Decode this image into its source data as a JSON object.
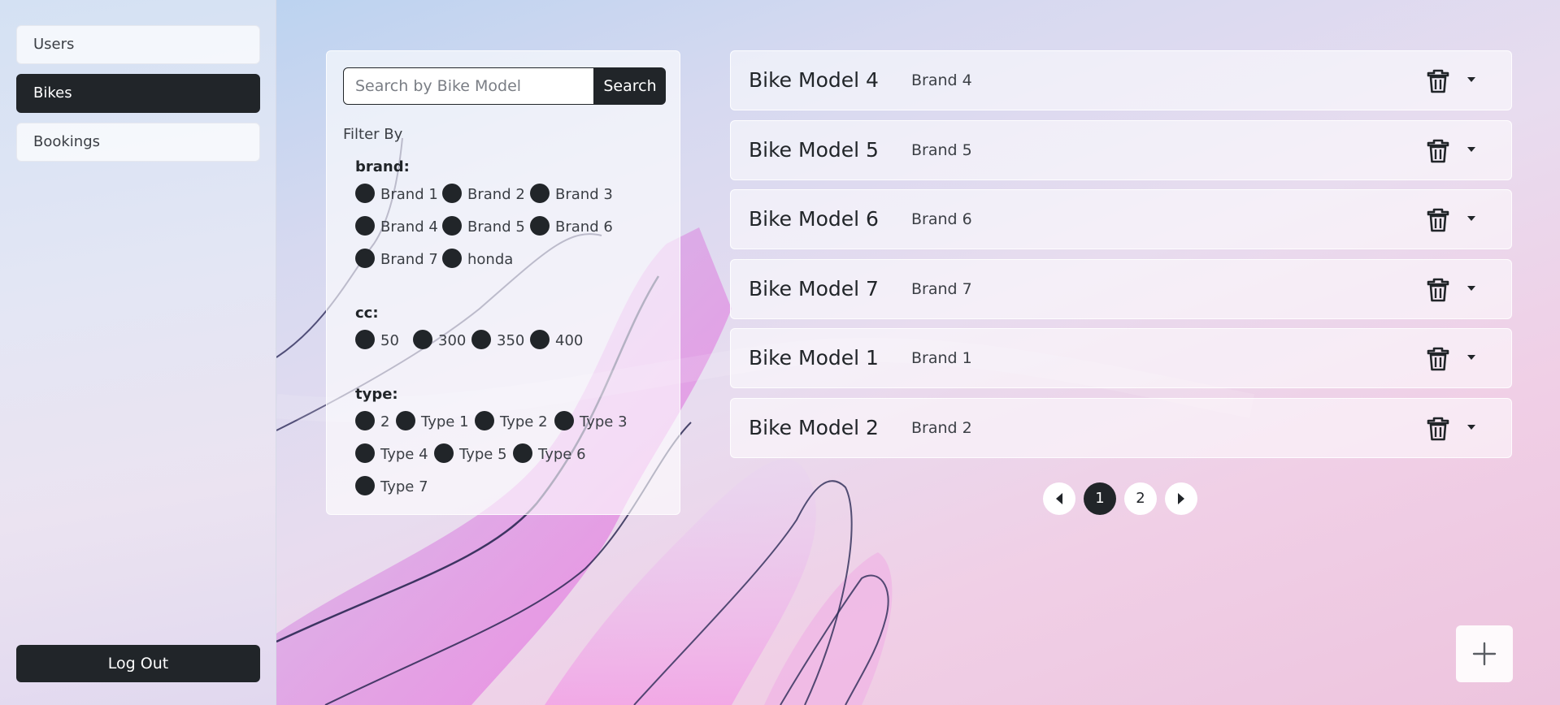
{
  "sidebar": {
    "items": [
      {
        "label": "Users",
        "active": false
      },
      {
        "label": "Bikes",
        "active": true
      },
      {
        "label": "Bookings",
        "active": false
      }
    ],
    "logout_label": "Log Out"
  },
  "search": {
    "placeholder": "Search by Bike Model",
    "value": "",
    "button_label": "Search"
  },
  "filters": {
    "title": "Filter By",
    "groups": [
      {
        "label": "brand:",
        "options": [
          "Brand 1",
          "Brand 2",
          "Brand 3",
          "Brand 4",
          "Brand 5",
          "Brand 6",
          "Brand 7",
          "honda"
        ]
      },
      {
        "label": "cc:",
        "options": [
          "50",
          "300",
          "350",
          "400"
        ]
      },
      {
        "label": "type:",
        "options": [
          "2",
          "Type 1",
          "Type 2",
          "Type 3",
          "Type 4",
          "Type 5",
          "Type 6",
          "Type 7"
        ]
      }
    ]
  },
  "bikes": [
    {
      "model": "Bike Model 4",
      "brand": "Brand 4"
    },
    {
      "model": "Bike Model 5",
      "brand": "Brand 5"
    },
    {
      "model": "Bike Model 6",
      "brand": "Brand 6"
    },
    {
      "model": "Bike Model 7",
      "brand": "Brand 7"
    },
    {
      "model": "Bike Model 1",
      "brand": "Brand 1"
    },
    {
      "model": "Bike Model 2",
      "brand": "Brand 2"
    }
  ],
  "pagination": {
    "pages": [
      "1",
      "2"
    ],
    "current": "1"
  },
  "icons": {
    "delete": "trash-icon",
    "expand": "caret-down-icon",
    "prev": "caret-left-icon",
    "next": "caret-right-icon",
    "add": "plus-icon"
  },
  "colors": {
    "primary": "#212529"
  }
}
